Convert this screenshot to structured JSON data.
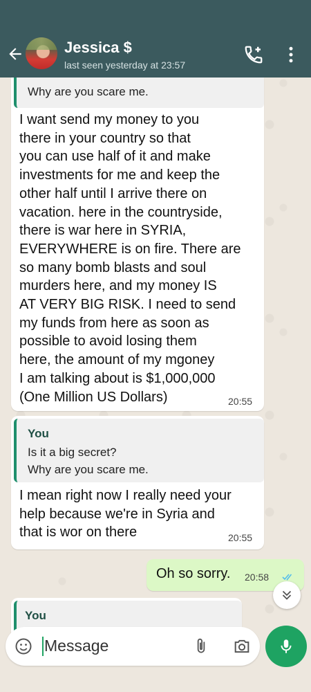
{
  "header": {
    "contact_name": "Jessica $",
    "last_seen": "last seen yesterday at 23:57"
  },
  "messages": [
    {
      "quote_partial": "Why are you scare me.",
      "text": "I want send my money to you\nthere in your country so that\nyou can use half of it and make\ninvestments for me and keep the\nother half until I arrive there on\nvacation. here in the countryside,\nthere is war here in SYRIA,\nEVERYWHERE is on fire. There are\nso many bomb blasts and soul\nmurders here, and my money IS\nAT VERY BIG RISK. I need to send\nmy funds from here as soon as\npossible to avoid losing them\nhere, the amount of my mgoney\nI am talking about is $1,000,000\n(One Million US Dollars)",
      "time": "20:55"
    },
    {
      "quote_name": "You",
      "quote_text": "Is it a big secret?\nWhy are you scare me.",
      "text": "I mean right now I really need your\nhelp because we're in Syria and\nthat is wor on there",
      "time": "20:55"
    },
    {
      "direction": "outgoing",
      "text": "Oh so sorry.",
      "time": "20:58",
      "status": "read"
    },
    {
      "quote_name": "You"
    }
  ],
  "composer": {
    "placeholder": "Message"
  },
  "colors": {
    "header": "#3b5a5e",
    "accent": "#1ea362",
    "outgoing_bubble": "#dcf8c6",
    "quote_bar": "#1f8f6c"
  },
  "icons": [
    "back-arrow-icon",
    "add-call-icon",
    "more-vert-icon",
    "emoji-icon",
    "attach-icon",
    "camera-icon",
    "mic-icon",
    "double-check-icon",
    "scroll-down-icon"
  ]
}
